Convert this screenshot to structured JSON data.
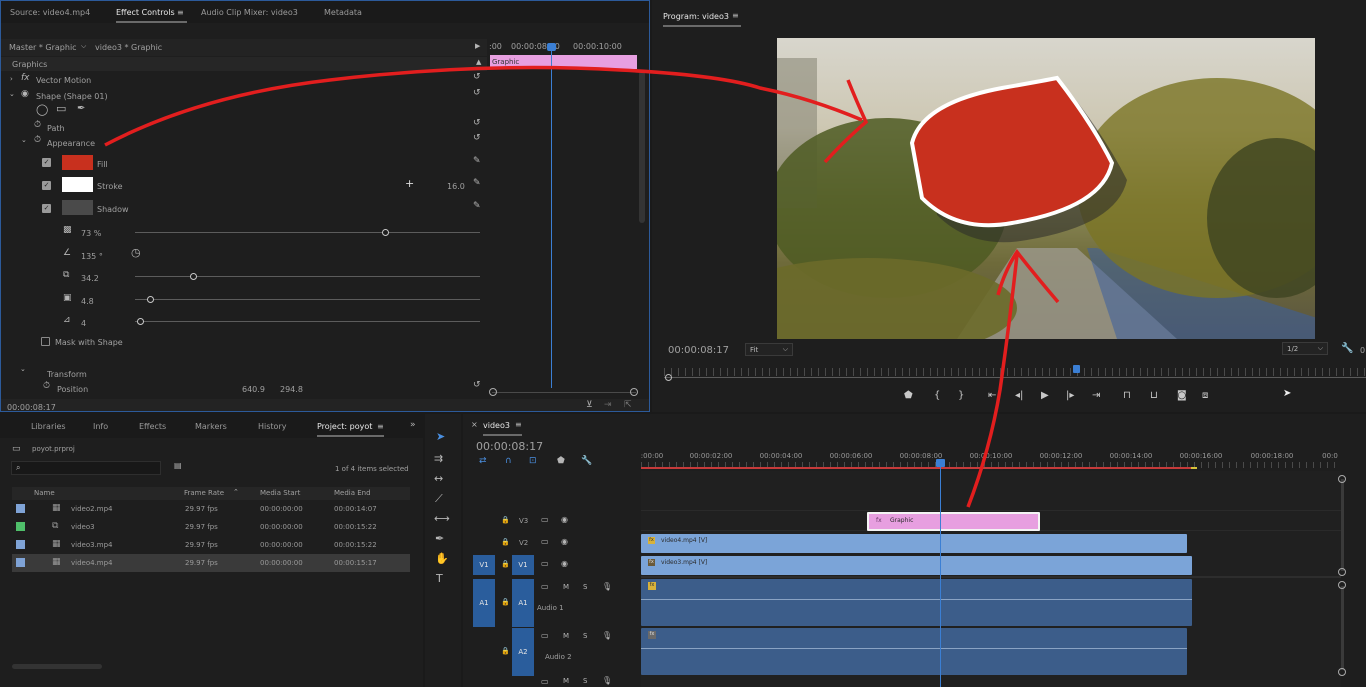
{
  "effect_panel": {
    "tabs": [
      "Source: video4.mp4",
      "Effect Controls",
      "Audio Clip Mixer: video3",
      "Metadata"
    ],
    "breadcrumb_master": "Master * Graphic",
    "breadcrumb_clip": "video3 * Graphic",
    "mini_time_start": ":00",
    "mini_time_mid": "00:00:08:00",
    "mini_time_end": "00:00:10:00",
    "graphic_clip_label": "Graphic",
    "section_graphics": "Graphics",
    "vector_motion": "Vector Motion",
    "shape_label": "Shape (Shape 01)",
    "path_label": "Path",
    "appearance_label": "Appearance",
    "fill_label": "Fill",
    "stroke_label": "Stroke",
    "stroke_value": "16.0",
    "shadow_label": "Shadow",
    "shadow_opacity": "73 %",
    "shadow_angle": "135 °",
    "shadow_distance": "34.2",
    "shadow_size": "4.8",
    "shadow_blur": "4",
    "mask_with_shape": "Mask with Shape",
    "transform_label": "Transform",
    "position_label": "Position",
    "position_x": "640.9",
    "position_y": "294.8",
    "current_time": "00:00:08:17",
    "fill_color": "#c8301e",
    "stroke_color": "#ffffff",
    "shadow_color": "#4a4a4a"
  },
  "program_monitor": {
    "title": "Program: video3",
    "timecode": "00:00:08:17",
    "fit_label": "Fit",
    "resolution_label": "1/2",
    "right_edge": "0"
  },
  "project_panel": {
    "tabs": [
      "Libraries",
      "Info",
      "Effects",
      "Markers",
      "History",
      "Project: poyot"
    ],
    "project_file": "poyot.prproj",
    "items_count": "1 of 4 items selected",
    "columns": [
      "Name",
      "Frame Rate",
      "Media Start",
      "Media End"
    ],
    "rows": [
      {
        "name": "video2.mp4",
        "fps": "29.97 fps",
        "start": "00:00:00:00",
        "end": "00:00:14:07",
        "color": "#7fa3d6"
      },
      {
        "name": "video3",
        "fps": "29.97 fps",
        "start": "00:00:00:00",
        "end": "00:00:15:22",
        "color": "#4fbf6a"
      },
      {
        "name": "video3.mp4",
        "fps": "29.97 fps",
        "start": "00:00:00:00",
        "end": "00:00:15:22",
        "color": "#7fa3d6"
      },
      {
        "name": "video4.mp4",
        "fps": "29.97 fps",
        "start": "00:00:00:00",
        "end": "00:00:15:17",
        "color": "#7fa3d6"
      }
    ]
  },
  "timeline": {
    "sequence_name": "video3",
    "timecode": "00:00:08:17",
    "ruler": [
      ":00:00",
      "00:00:02:00",
      "00:00:04:00",
      "00:00:06:00",
      "00:00:08:00",
      "00:00:10:00",
      "00:00:12:00",
      "00:00:14:00",
      "00:00:16:00",
      "00:00:18:00",
      "00:0"
    ],
    "tracks": {
      "v3": "V3",
      "v2": "V2",
      "v1": "V1",
      "v1_src": "V1",
      "a1": "A1",
      "a1_src": "A1",
      "a1_name": "Audio 1",
      "a2": "A2",
      "a2_name": "Audio 2"
    },
    "clips": {
      "graphic": "Graphic",
      "video4": "video4.mp4 [V]",
      "video3": "video3.mp4 [V]"
    },
    "graphic_color": "#e79fe0",
    "video_color": "#7ba4d8",
    "audio_color": "#3c5d8a"
  }
}
